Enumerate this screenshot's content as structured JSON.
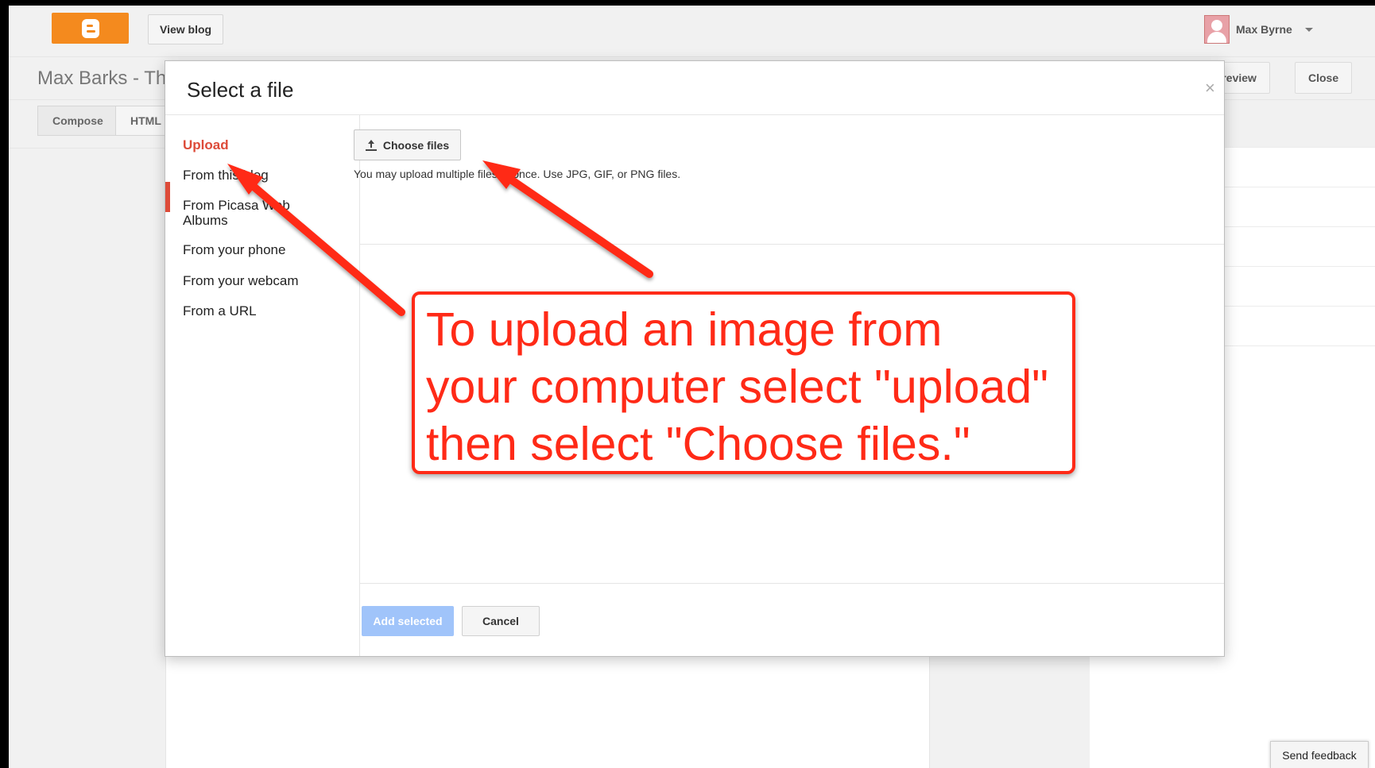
{
  "header": {
    "view_blog_label": "View blog",
    "user_name": "Max Byrne"
  },
  "editor": {
    "post_title": "Max Barks - Th",
    "preview_label": "Preview",
    "close_label": "Close",
    "tabs": [
      "Compose",
      "HTML"
    ]
  },
  "dialog": {
    "title": "Select a file",
    "close_glyph": "×",
    "sidebar": [
      {
        "label": "Upload",
        "active": true
      },
      {
        "label": "From this blog"
      },
      {
        "label": "From Picasa Web Albums"
      },
      {
        "label": "From your phone"
      },
      {
        "label": "From your webcam"
      },
      {
        "label": "From a URL"
      }
    ],
    "choose_files_label": "Choose files",
    "hint": "You may upload multiple files at once. Use JPG, GIF, or PNG files.",
    "add_selected_label": "Add selected",
    "cancel_label": "Cancel"
  },
  "feedback_label": "Send feedback",
  "annotation": {
    "text": "To upload an image from\nyour computer select \"upload\"\nthen select \"Choose files.\"",
    "color": "#ff2a17"
  },
  "colors": {
    "blogger_orange": "#f48a1e",
    "active_red": "#dd4b39",
    "disabled_blue": "#a0c4fa"
  }
}
